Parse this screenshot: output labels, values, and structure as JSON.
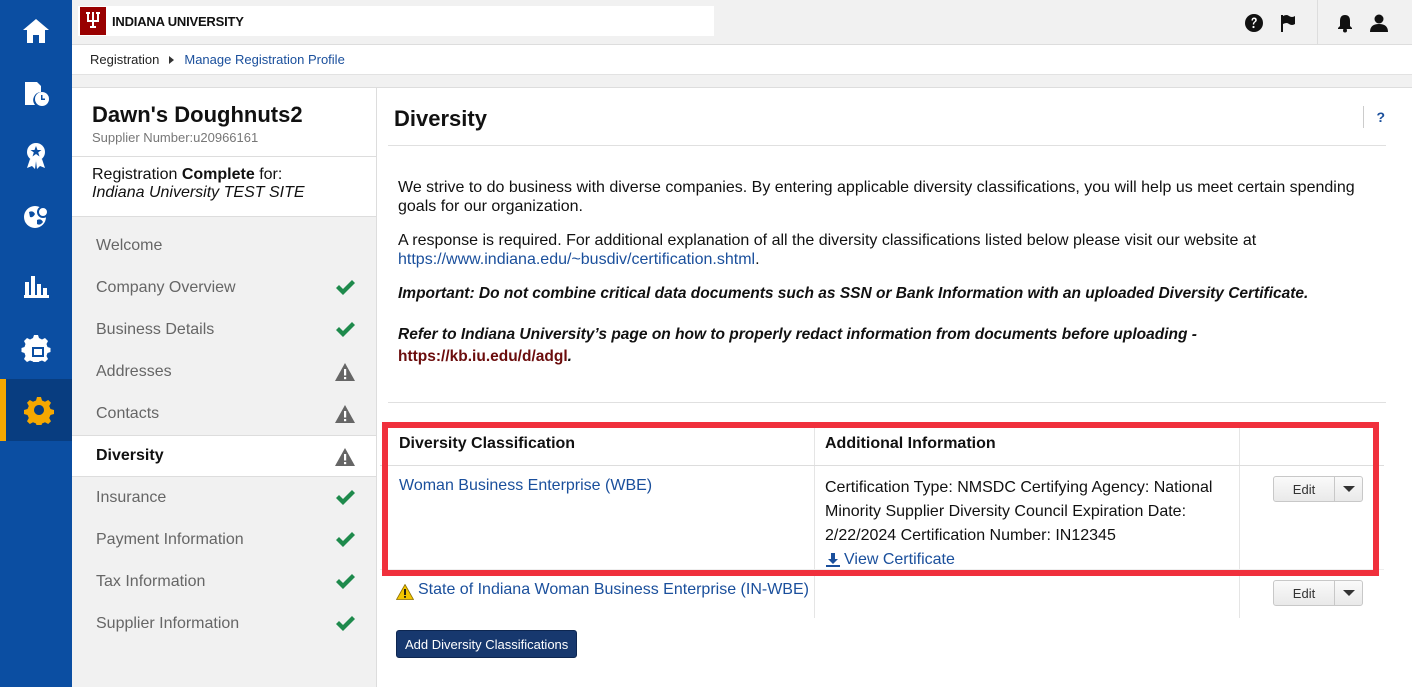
{
  "brand": {
    "name": "INDIANA UNIVERSITY",
    "accent_color": "#990000"
  },
  "rail": {
    "items": [
      {
        "icon": "home-icon"
      },
      {
        "icon": "documents-clock-icon"
      },
      {
        "icon": "badge-icon"
      },
      {
        "icon": "globe-icon"
      },
      {
        "icon": "bar-chart-icon"
      },
      {
        "icon": "gear-lock-icon"
      },
      {
        "icon": "gear-icon",
        "active": true
      }
    ],
    "active_color": "#f6a800",
    "background": "#0b4ea2"
  },
  "topbar": {
    "icons": [
      "help-circle-icon",
      "flag-icon",
      "bell-icon",
      "user-icon"
    ]
  },
  "breadcrumb": {
    "root": "Registration",
    "current": "Manage Registration Profile"
  },
  "supplier": {
    "name": "Dawn's Doughnuts2",
    "number": "Supplier Number:u20966161"
  },
  "registration": {
    "prefix": "Registration",
    "status": "Complete",
    "suffix": "for:",
    "site": "Indiana University TEST SITE"
  },
  "nav": {
    "items": [
      {
        "label": "Welcome",
        "status": "none"
      },
      {
        "label": "Company Overview",
        "status": "complete"
      },
      {
        "label": "Business Details",
        "status": "complete"
      },
      {
        "label": "Addresses",
        "status": "warning"
      },
      {
        "label": "Contacts",
        "status": "warning"
      },
      {
        "label": "Diversity",
        "status": "warning",
        "active": true
      },
      {
        "label": "Insurance",
        "status": "complete"
      },
      {
        "label": "Payment Information",
        "status": "complete"
      },
      {
        "label": "Tax Information",
        "status": "complete"
      },
      {
        "label": "Supplier Information",
        "status": "complete"
      }
    ],
    "complete_color": "#1e8a4c",
    "warning_color": "#666666"
  },
  "main": {
    "title": "Diversity",
    "help": "?",
    "intro1": "We strive to do business with diverse companies. By entering applicable diversity classifications, you will help us meet certain spending goals for our organization.",
    "intro2_text": "A response is required. For additional explanation of all the diversity classifications listed below please visit our website at",
    "intro2_link": "https://www.indiana.edu/~busdiv/certification.shtml",
    "intro2_end": ".",
    "important": "Important: Do not combine critical data documents such as SSN or Bank Information with an uploaded Diversity Certificate.",
    "refer_text": "Refer to Indiana University’s page on how to properly redact information from documents before uploading -",
    "refer_link": "https://kb.iu.edu/d/adgl",
    "refer_end": ".",
    "table": {
      "headers": [
        "Diversity Classification",
        "Additional Information"
      ],
      "rows": [
        {
          "classification": "Woman Business Enterprise (WBE)",
          "info": "Certification Type: NMSDC Certifying Agency: National Minority Supplier Diversity Council Expiration Date: 2/22/2024 Certification Number: IN12345",
          "cert_link": "View Certificate",
          "edit": "Edit"
        },
        {
          "classification": "State of Indiana Woman Business Enterprise (IN-WBE)",
          "info": "",
          "edit": "Edit",
          "warning": true
        }
      ]
    },
    "add_button": "Add Diversity Classifications",
    "highlight_color": "#f0303c"
  }
}
